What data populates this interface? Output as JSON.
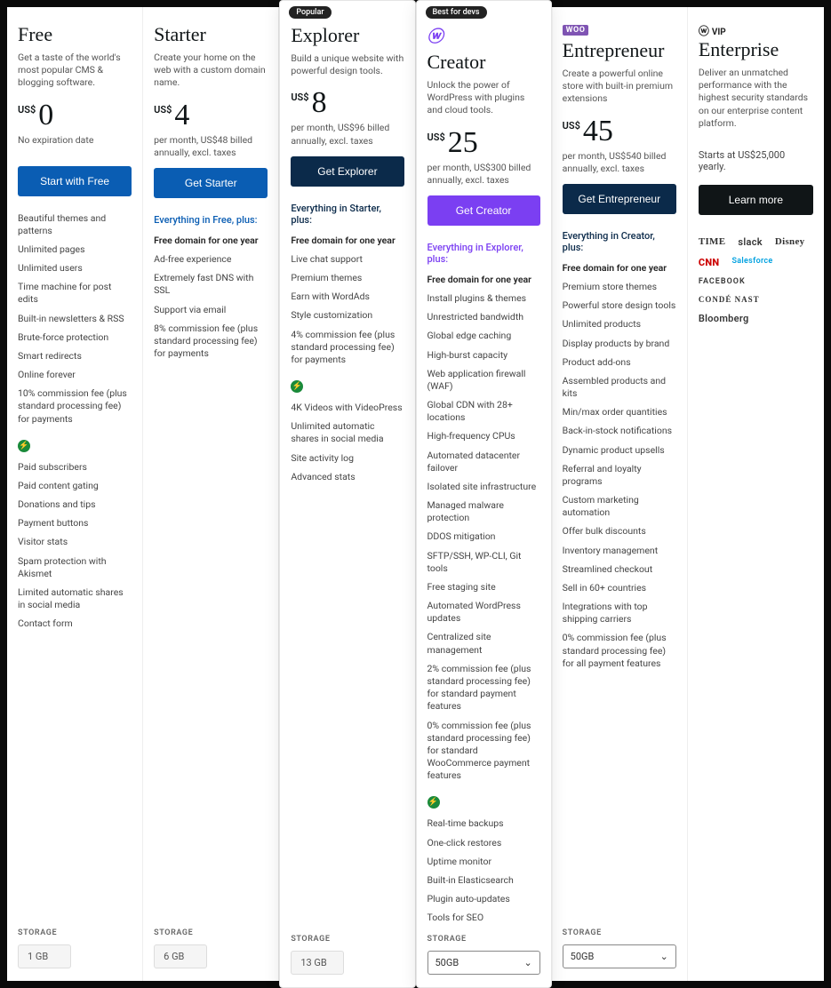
{
  "plans": {
    "free": {
      "name": "Free",
      "desc": "Get a taste of the world's most popular CMS & blogging software.",
      "currency": "US$",
      "price": "0",
      "sub": "No expiration date",
      "cta": "Start with Free",
      "features": [
        "Beautiful themes and patterns",
        "Unlimited pages",
        "Unlimited users",
        "Time machine for post edits",
        "Built-in newsletters & RSS",
        "Brute-force protection",
        "Smart redirects",
        "Online forever",
        "10% commission fee (plus standard processing fee) for payments"
      ],
      "extras": [
        "Paid subscribers",
        "Paid content gating",
        "Donations and tips",
        "Payment buttons",
        "Visitor stats",
        "Spam protection with Akismet",
        "Limited automatic shares in social media",
        "Contact form"
      ],
      "storage_label": "STORAGE",
      "storage": "1 GB"
    },
    "starter": {
      "name": "Starter",
      "desc": "Create your home on the web with a custom domain name.",
      "currency": "US$",
      "price": "4",
      "sub": "per month, US$48 billed annually, excl. taxes",
      "cta": "Get Starter",
      "inherits": "Everything in Free, plus:",
      "features": [
        "Free domain for one year",
        "Ad-free experience",
        "Extremely fast DNS with SSL",
        "Support via email",
        "8% commission fee (plus standard processing fee) for payments"
      ],
      "storage_label": "STORAGE",
      "storage": "6 GB"
    },
    "explorer": {
      "badge": "Popular",
      "name": "Explorer",
      "desc": "Build a unique website with powerful design tools.",
      "currency": "US$",
      "price": "8",
      "sub": "per month, US$96 billed annually, excl. taxes",
      "cta": "Get Explorer",
      "inherits": "Everything in Starter, plus:",
      "features": [
        "Free domain for one year",
        "Live chat support",
        "Premium themes",
        "Earn with WordAds",
        "Style customization",
        "4% commission fee (plus standard processing fee) for payments"
      ],
      "extras": [
        "4K Videos with VideoPress",
        "Unlimited automatic shares in social media",
        "Site activity log",
        "Advanced stats"
      ],
      "storage_label": "STORAGE",
      "storage": "13 GB"
    },
    "creator": {
      "badge": "Best for devs",
      "icon": "W",
      "name": "Creator",
      "desc": "Unlock the power of WordPress with plugins and cloud tools.",
      "currency": "US$",
      "price": "25",
      "sub": "per month, US$300 billed annually, excl. taxes",
      "cta": "Get Creator",
      "inherits": "Everything in Explorer, plus:",
      "features": [
        "Free domain for one year",
        "Install plugins & themes",
        "Unrestricted bandwidth",
        "Global edge caching",
        "High-burst capacity",
        "Web application firewall (WAF)",
        "Global CDN with 28+ locations",
        "High-frequency CPUs",
        "Automated datacenter failover",
        "Isolated site infrastructure",
        "Managed malware protection",
        "DDOS mitigation",
        "SFTP/SSH, WP-CLI, Git tools",
        "Free staging site",
        "Automated WordPress updates",
        "Centralized site management",
        "2% commission fee (plus standard processing fee) for standard payment features",
        "0% commission fee (plus standard processing fee) for standard WooCommerce payment features"
      ],
      "extras": [
        "Real-time backups",
        "One-click restores",
        "Uptime monitor",
        "Built-in Elasticsearch",
        "Plugin auto-updates",
        "Tools for SEO"
      ],
      "storage_label": "STORAGE",
      "storage": "50GB"
    },
    "entrepreneur": {
      "icon": "WOO",
      "name": "Entrepreneur",
      "desc": "Create a powerful online store with built-in premium extensions",
      "currency": "US$",
      "price": "45",
      "sub": "per month, US$540 billed annually, excl. taxes",
      "cta": "Get Entrepreneur",
      "inherits": "Everything in Creator, plus:",
      "features": [
        "Free domain for one year",
        "Premium store themes",
        "Powerful store design tools",
        "Unlimited products",
        "Display products by brand",
        "Product add-ons",
        "Assembled products and kits",
        "Min/max order quantities",
        "Back-in-stock notifications",
        "Dynamic product upsells",
        "Referral and loyalty programs",
        "Custom marketing automation",
        "Offer bulk discounts",
        "Inventory management",
        "Streamlined checkout",
        "Sell in 60+ countries",
        "Integrations with top shipping carriers",
        "0% commission fee (plus standard processing fee) for all payment features"
      ],
      "storage_label": "STORAGE",
      "storage": "50GB"
    },
    "enterprise": {
      "icon": "ⓦ VIP",
      "name": "Enterprise",
      "desc": "Deliver an unmatched performance with the highest security standards on our enterprise content platform.",
      "start": "Starts at US$25,000 yearly.",
      "cta": "Learn more",
      "logos": [
        "TIME",
        "slack",
        "Disney",
        "CNN",
        "Salesforce",
        "FACEBOOK",
        "CONDÉ NAST",
        "Bloomberg"
      ]
    }
  }
}
